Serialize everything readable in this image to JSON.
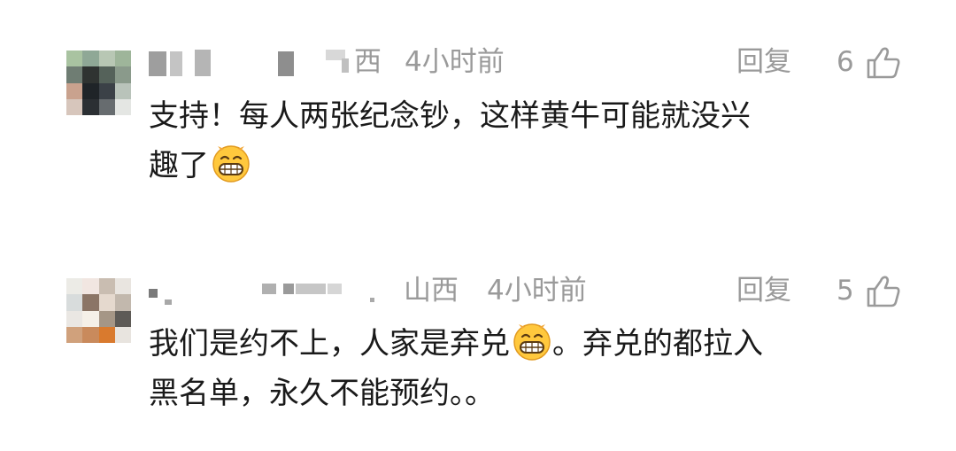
{
  "comments": [
    {
      "location": "西",
      "time": "4小时前",
      "reply_label": "回复",
      "likes": "6",
      "text_line1": "支持！每人两张纪念钞，这样黄牛可能就没兴",
      "text_line2": "趣了",
      "emoji": "grinning-face"
    },
    {
      "location": "山西",
      "time": "4小时前",
      "reply_label": "回复",
      "likes": "5",
      "text_line1_a": "我们是约不上，人家是弃兑",
      "text_line1_b": "。弃兑的都拉入",
      "text_line2": "黑名单，永久不能预约。。",
      "emoji": "grinning-face"
    }
  ],
  "colors": {
    "meta_text": "#9a9a9a",
    "body_text": "#1a1a1a",
    "emoji_face": "#ffc83d"
  }
}
